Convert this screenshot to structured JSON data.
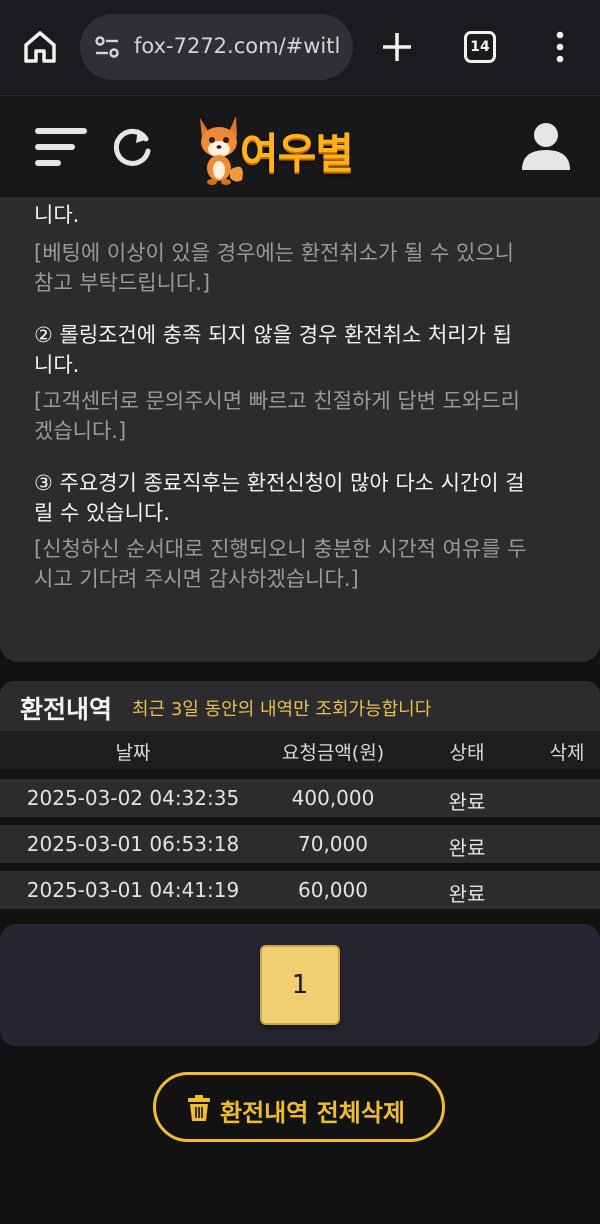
{
  "browser": {
    "url": "fox-7272.com/#witl",
    "tab_count": "14"
  },
  "header": {
    "logo_text": "여우별"
  },
  "notice": {
    "fragment": "니다.",
    "fragment_sub_1": "[베팅에 이상이 있을 경우에는 환전취소가 될 수 있으니",
    "fragment_sub_2": "참고 부탁드립니다.]",
    "item2_line1": "② 롤링조건에 충족 되지 않을 경우 환전취소 처리가 됩",
    "item2_line2": "니다.",
    "item2_sub_1": "[고객센터로 문의주시면 빠르고 친절하게 답변 도와드리",
    "item2_sub_2": "겠습니다.]",
    "item3_line1": "③ 주요경기 종료직후는 환전신청이 많아 다소 시간이 걸",
    "item3_line2": "릴 수 있습니다.",
    "item3_sub_1": "[신청하신 순서대로 진행되오니 충분한 시간적 여유를 두",
    "item3_sub_2": "시고 기다려 주시면 감사하겠습니다.]"
  },
  "history": {
    "title": "환전내역",
    "note": "최근 3일 동안의 내역만 조회가능합니다",
    "columns": [
      "날짜",
      "요청금액(원)",
      "상태",
      "삭제"
    ],
    "rows": [
      {
        "date": "2025-03-02 04:32:35",
        "amount": "400,000",
        "status": "완료"
      },
      {
        "date": "2025-03-01 06:53:18",
        "amount": "70,000",
        "status": "완료"
      },
      {
        "date": "2025-03-01 04:41:19",
        "amount": "60,000",
        "status": "완료"
      }
    ]
  },
  "pagination": {
    "current_page": "1"
  },
  "actions": {
    "delete_all_label": "환전내역 전체삭제"
  },
  "colors": {
    "accent_gold": "#f0bd2f",
    "note_yellow": "#e7c04e",
    "page_active": "#f0cf72",
    "panel_bg": "#2c2c2f"
  }
}
